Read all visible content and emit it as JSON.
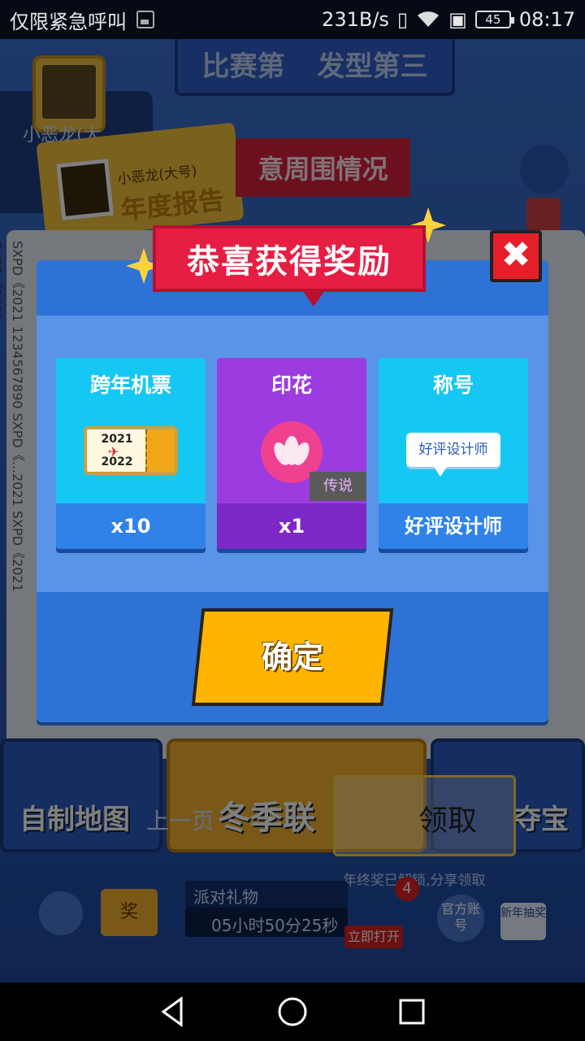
{
  "status_bar": {
    "carrier": "仅限紧急呼叫",
    "net_speed": "231B/s",
    "battery": "45",
    "time": "08:17"
  },
  "background": {
    "top_banner": [
      "比赛第",
      "发型第三"
    ],
    "player_name": "小恶龙(大",
    "card_player": "小恶龙(大号)",
    "card_title": "年度报告",
    "red_banner": "意周围情况",
    "book_side_text": "SXPD《2021 1234567890 SXPD《...2021 SXPD《2021 SXPD《2021",
    "tiles": {
      "map": "自制地图",
      "prev": "上一页",
      "winter": "冬季联",
      "collect": "领取",
      "treasure": "夺宝"
    },
    "unlock_tip": "年终奖已解锁,分享领取",
    "gift_label": "派对礼物",
    "timer": "05小时50分25秒",
    "open_now": "立即打开",
    "badge_count": "4",
    "official": "官方账号",
    "new_year": "新年抽奖",
    "tv_label": "奖"
  },
  "modal": {
    "title": "恭喜获得奖励",
    "close_symbol": "✖",
    "rewards": [
      {
        "title": "跨年机票",
        "amount": "x10",
        "ticket_top": "2021",
        "ticket_bottom": "2022"
      },
      {
        "title": "印花",
        "amount": "x1",
        "rarity": "传说"
      },
      {
        "title": "称号",
        "amount": "好评设计师",
        "badge_text": "好评设计师"
      }
    ],
    "confirm_label": "确定"
  },
  "colors": {
    "accent_red": "#e61e44",
    "confirm_yellow": "#ffb400",
    "card_cyan": "#15c8f4",
    "card_purple": "#9c3ce0",
    "modal_blue": "#2f72d6"
  }
}
